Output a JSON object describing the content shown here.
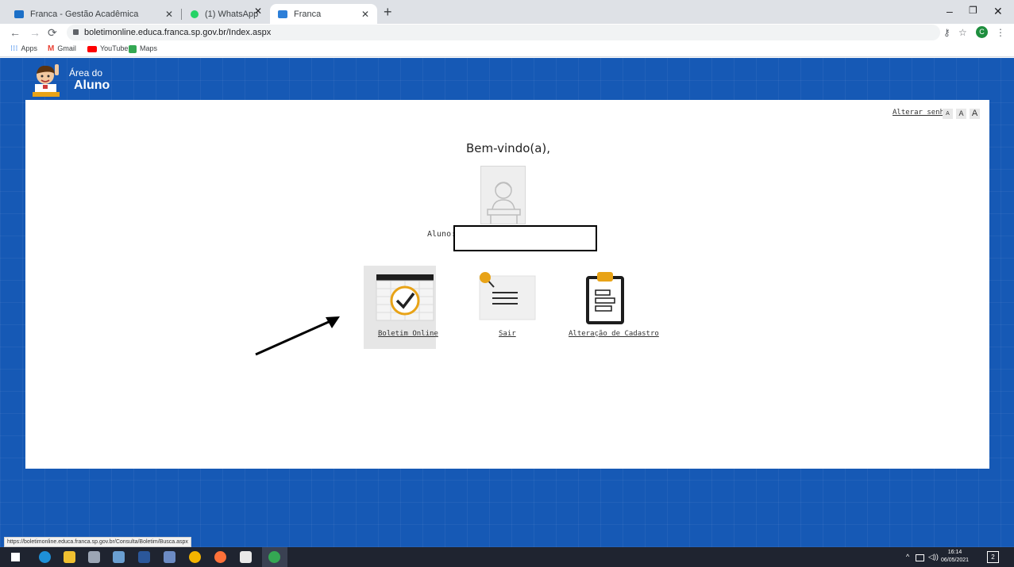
{
  "browser": {
    "tabs": [
      {
        "title": "Franca - Gestão Acadêmica",
        "active": false
      },
      {
        "title": "(1) WhatsApp",
        "active": false
      },
      {
        "title": "Franca",
        "active": true
      }
    ],
    "url": "boletimonline.educa.franca.sp.gov.br/Index.aspx",
    "profile_initial": "C",
    "bookmarks": [
      "Apps",
      "Gmail",
      "YouTube",
      "Maps"
    ]
  },
  "header": {
    "brand_line1": "Área do",
    "brand_line2": "Aluno"
  },
  "toolbar": {
    "change_password": "Alterar senha",
    "font_sizes": [
      "A",
      "A",
      "A"
    ]
  },
  "main": {
    "welcome": "Bem-vindo(a),",
    "student_label": "Aluno:",
    "student_name": "",
    "tiles": [
      {
        "label": "Boletim Online",
        "icon": "report-card-icon",
        "selected": true
      },
      {
        "label": "Sair",
        "icon": "exit-note-icon",
        "selected": false
      },
      {
        "label": "Alteração de Cadastro",
        "icon": "clipboard-icon",
        "selected": false
      }
    ]
  },
  "status_url": "https://boletimonline.educa.franca.sp.gov.br/Consulta/Boletim/Busca.aspx",
  "taskbar": {
    "time": "16:14",
    "date": "06/05/2021",
    "notification_count": "2"
  },
  "colors": {
    "page_blue": "#1659b5",
    "accent_gold": "#e8a317"
  }
}
